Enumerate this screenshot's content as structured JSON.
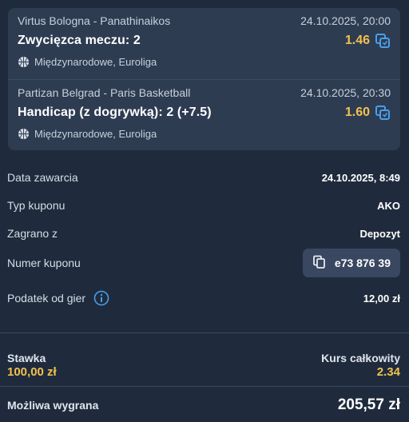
{
  "bets": [
    {
      "match": "Virtus Bologna - Panathinaikos",
      "datetime": "24.10.2025, 20:00",
      "selection": "Zwycięzca meczu: 2",
      "odds": "1.46",
      "league": "Międzynarodowe, Euroliga",
      "sport_icon": "basketball-icon"
    },
    {
      "match": "Partizan Belgrad - Paris Basketball",
      "datetime": "24.10.2025, 20:30",
      "selection": "Handicap (z dogrywką): 2 (+7.5)",
      "odds": "1.60",
      "league": "Międzynarodowe, Euroliga",
      "sport_icon": "basketball-icon"
    }
  ],
  "details": {
    "date_label": "Data zawarcia",
    "date_value": "24.10.2025, 8:49",
    "type_label": "Typ kuponu",
    "type_value": "AKO",
    "played_label": "Zagrano z",
    "played_value": "Depozyt",
    "coupon_label": "Numer kuponu",
    "coupon_value": "e73 876 39",
    "tax_label": "Podatek od gier",
    "tax_value": "12,00 zł"
  },
  "summary": {
    "stake_label": "Stawka",
    "stake_value": "100,00 zł",
    "total_odds_label": "Kurs całkowity",
    "total_odds_value": "2.34",
    "win_label": "Możliwa wygrana",
    "win_value": "205,57 zł"
  },
  "colors": {
    "background": "#1f2b3c",
    "card": "#2e3c52",
    "accent_yellow": "#f2c14e",
    "icon_blue": "#4a9eea"
  }
}
